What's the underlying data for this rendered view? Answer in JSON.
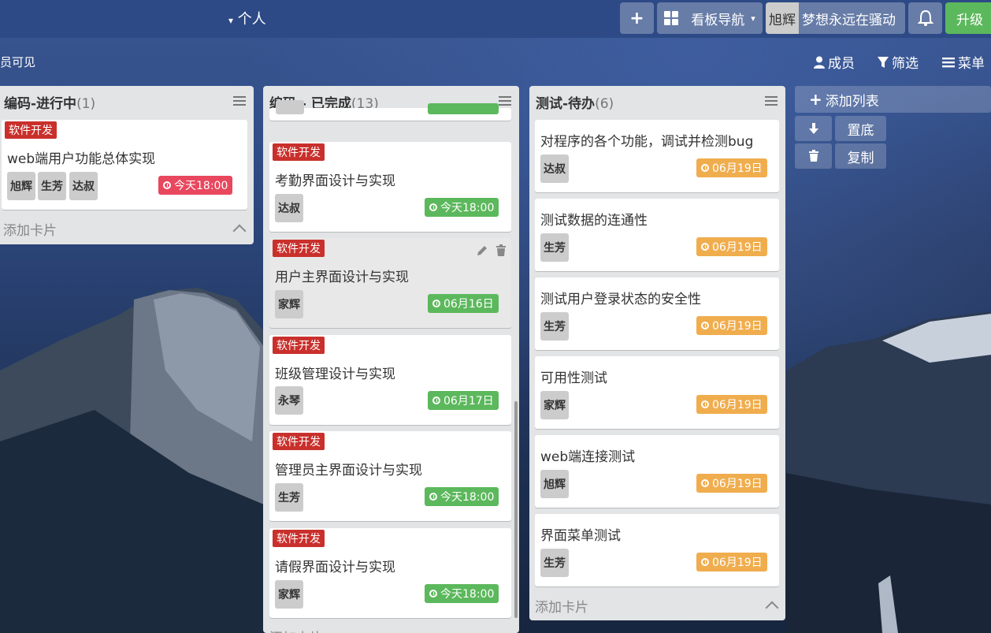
{
  "header": {
    "board_title": "个人",
    "board_nav_label": "看板导航",
    "user_name": "旭辉",
    "user_motto": "梦想永远在骚动",
    "upgrade_label": "升级"
  },
  "subbar": {
    "visibility": "员可见",
    "members_label": "成员",
    "filter_label": "筛选",
    "menu_label": "菜单"
  },
  "lists": [
    {
      "title": "编码-进行中",
      "count": "(1)",
      "add_card": "添加卡片",
      "cards": [
        {
          "label": "软件开发",
          "title": "web端用户功能总体实现",
          "members": [
            "旭辉",
            "生芳",
            "达叔"
          ],
          "due": "今天18:00"
        }
      ]
    },
    {
      "title": "编码 - 已完成",
      "count": "(13)",
      "add_card": "添加卡片",
      "cards": [
        {
          "label": "软件开发",
          "title": "考勤界面设计与实现",
          "members": [
            "达叔"
          ],
          "due": "今天18:00"
        },
        {
          "label": "软件开发",
          "title": "用户主界面设计与实现",
          "members": [
            "家辉"
          ],
          "due": "06月16日"
        },
        {
          "label": "软件开发",
          "title": "班级管理设计与实现",
          "members": [
            "永琴"
          ],
          "due": "06月17日"
        },
        {
          "label": "软件开发",
          "title": "管理员主界面设计与实现",
          "members": [
            "生芳"
          ],
          "due": "今天18:00"
        },
        {
          "label": "软件开发",
          "title": "请假界面设计与实现",
          "members": [
            "家辉"
          ],
          "due": "今天18:00"
        }
      ]
    },
    {
      "title": "测试-待办",
      "count": "(6)",
      "add_card": "添加卡片",
      "cards": [
        {
          "title": "对程序的各个功能，调试并检测bug",
          "members": [
            "达叔"
          ],
          "due": "06月19日"
        },
        {
          "title": "测试数据的连通性",
          "members": [
            "生芳"
          ],
          "due": "06月19日"
        },
        {
          "title": "测试用户登录状态的安全性",
          "members": [
            "生芳"
          ],
          "due": "06月19日"
        },
        {
          "title": "可用性测试",
          "members": [
            "家辉"
          ],
          "due": "06月19日"
        },
        {
          "title": "web端连接测试",
          "members": [
            "旭辉"
          ],
          "due": "06月19日"
        },
        {
          "title": "界面菜单测试",
          "members": [
            "生芳"
          ],
          "due": "06月19日"
        }
      ]
    }
  ],
  "sidebar": {
    "add_list": "添加列表",
    "to_bottom": "置底",
    "copy": "复制"
  },
  "colors": {
    "label_red": "#c9302c",
    "due_green": "#5cb85c",
    "due_red": "#e8475d",
    "due_orange": "#f0ad4e",
    "upgrade_green": "#5cb85c"
  }
}
